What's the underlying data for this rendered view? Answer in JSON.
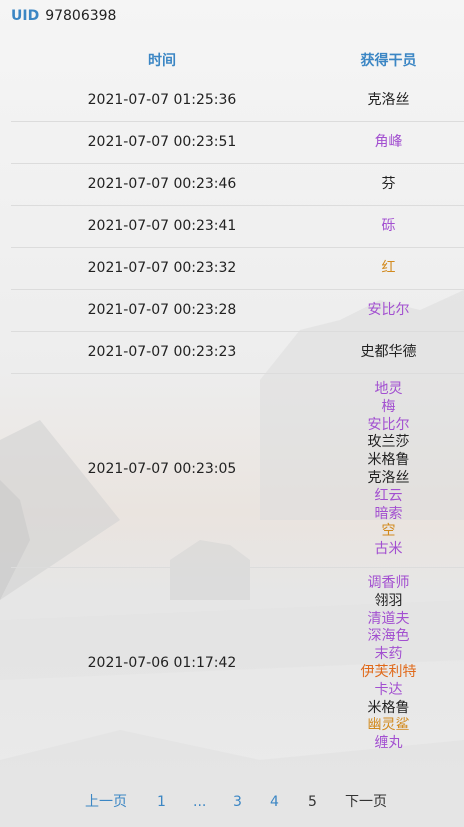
{
  "uid": {
    "label": "UID",
    "value": "97806398"
  },
  "table": {
    "headers": {
      "time": "时间",
      "operator": "获得干员"
    },
    "rows": [
      {
        "time": "2021-07-07 01:25:36",
        "operators": [
          {
            "name": "克洛丝",
            "color": "#222222"
          }
        ]
      },
      {
        "time": "2021-07-07 00:23:51",
        "operators": [
          {
            "name": "角峰",
            "color": "#a24fd0"
          }
        ]
      },
      {
        "time": "2021-07-07 00:23:46",
        "operators": [
          {
            "name": "芬",
            "color": "#222222"
          }
        ]
      },
      {
        "time": "2021-07-07 00:23:41",
        "operators": [
          {
            "name": "砾",
            "color": "#a24fd0"
          }
        ]
      },
      {
        "time": "2021-07-07 00:23:32",
        "operators": [
          {
            "name": "红",
            "color": "#d28a1e"
          }
        ]
      },
      {
        "time": "2021-07-07 00:23:28",
        "operators": [
          {
            "name": "安比尔",
            "color": "#a24fd0"
          }
        ]
      },
      {
        "time": "2021-07-07 00:23:23",
        "operators": [
          {
            "name": "史都华德",
            "color": "#222222"
          }
        ]
      },
      {
        "time": "2021-07-07 00:23:05",
        "operators": [
          {
            "name": "地灵",
            "color": "#a24fd0"
          },
          {
            "name": "梅",
            "color": "#a24fd0"
          },
          {
            "name": "安比尔",
            "color": "#a24fd0"
          },
          {
            "name": "玫兰莎",
            "color": "#222222"
          },
          {
            "name": "米格鲁",
            "color": "#222222"
          },
          {
            "name": "克洛丝",
            "color": "#222222"
          },
          {
            "name": "红云",
            "color": "#a24fd0"
          },
          {
            "name": "暗索",
            "color": "#a24fd0"
          },
          {
            "name": "空",
            "color": "#d28a1e"
          },
          {
            "name": "古米",
            "color": "#a24fd0"
          }
        ]
      },
      {
        "time": "2021-07-06 01:17:42",
        "operators": [
          {
            "name": "调香师",
            "color": "#a24fd0"
          },
          {
            "name": "翎羽",
            "color": "#222222"
          },
          {
            "name": "清道夫",
            "color": "#a24fd0"
          },
          {
            "name": "深海色",
            "color": "#a24fd0"
          },
          {
            "name": "末药",
            "color": "#a24fd0"
          },
          {
            "name": "伊芙利特",
            "color": "#e06a1b"
          },
          {
            "name": "卡达",
            "color": "#a24fd0"
          },
          {
            "name": "米格鲁",
            "color": "#222222"
          },
          {
            "name": "幽灵鲨",
            "color": "#d28a1e"
          },
          {
            "name": "缠丸",
            "color": "#a24fd0"
          }
        ]
      }
    ]
  },
  "pagination": {
    "prev": "上一页",
    "pages": [
      "1",
      "...",
      "3",
      "4",
      "5"
    ],
    "current": "5",
    "next": "下一页"
  },
  "colors": {
    "accent": "#3b86c4",
    "rarity4": "#a24fd0",
    "rarity5": "#d28a1e",
    "rarity6": "#e06a1b",
    "rarity3": "#222222"
  }
}
